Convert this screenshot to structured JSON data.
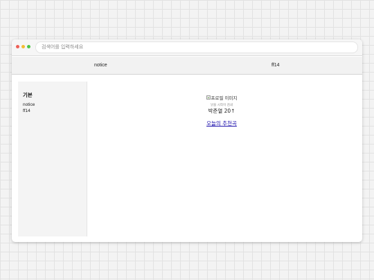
{
  "addressbar": {
    "placeholder": "검색어를 입력하세요"
  },
  "topnav": {
    "items": [
      {
        "label": "notice"
      },
      {
        "label": "ff14"
      }
    ]
  },
  "sidebar": {
    "title": "기본",
    "items": [
      {
        "label": "notice"
      },
      {
        "label": "ff14"
      }
    ]
  },
  "profile": {
    "image_alt": "프로필 이미지",
    "subtitle": "낡을 시작이 검내",
    "name": "박준열 20↑",
    "link": "오늘의 추천곡"
  },
  "colors": {
    "window_dot_red": "#ed5f56",
    "window_dot_yellow": "#f4bd33",
    "window_dot_green": "#4fc549",
    "link": "#1a0dab"
  }
}
